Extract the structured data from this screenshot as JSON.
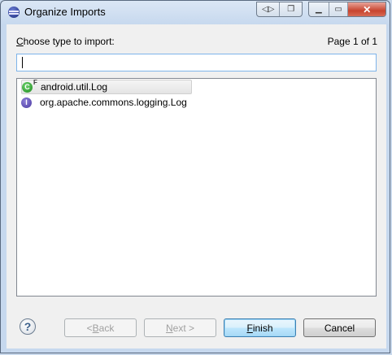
{
  "window": {
    "title": "Organize Imports"
  },
  "dialog": {
    "prompt_prefix": "C",
    "prompt_rest": "hoose type to import:",
    "page_indicator": "Page 1 of 1",
    "search_value": ""
  },
  "results": [
    {
      "name": "android.util.Log",
      "icon": "class-icon",
      "marker": "F",
      "selected": true
    },
    {
      "name": "org.apache.commons.logging.Log",
      "icon": "interface-icon",
      "selected": false
    }
  ],
  "buttons": {
    "back_prefix": "< ",
    "back_mnemonic": "B",
    "back_rest": "ack",
    "next_mnemonic": "N",
    "next_rest": "ext >",
    "finish_mnemonic": "F",
    "finish_rest": "inish",
    "cancel": "Cancel"
  },
  "colors": {
    "class_icon": "#2e9a2e",
    "interface_icon": "#5a48b0",
    "focus_border": "#3c7fb1"
  }
}
